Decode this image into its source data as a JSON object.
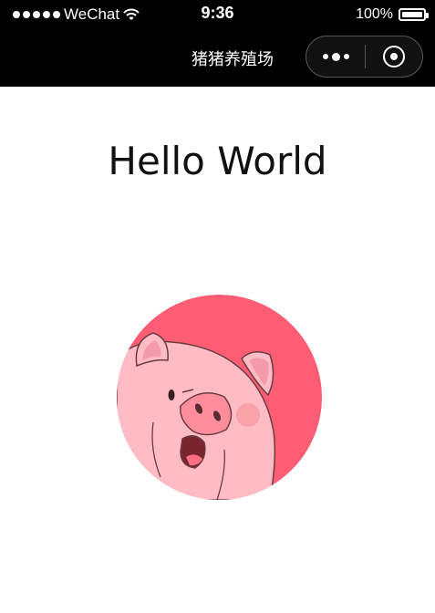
{
  "status_bar": {
    "carrier": "WeChat",
    "time": "9:36",
    "battery": "100%",
    "battery_level": 1.0
  },
  "nav": {
    "title": "猪猪养殖场",
    "more_icon": "more-dots-icon",
    "close_icon": "close-circle-icon"
  },
  "main": {
    "greeting": "Hello World",
    "avatar": "pig-avatar"
  },
  "colors": {
    "avatar_bg": "#ff5d73",
    "pig_body": "#ffbcc5",
    "pig_outline": "#6b3b42"
  }
}
